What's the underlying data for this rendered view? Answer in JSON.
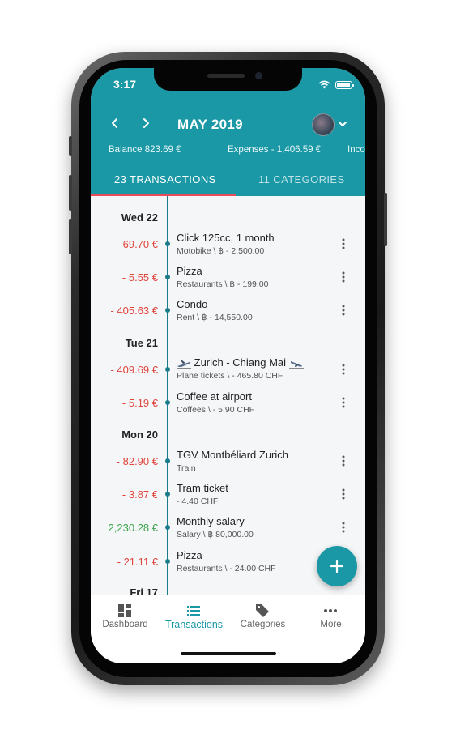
{
  "status_bar": {
    "time": "3:17"
  },
  "header": {
    "month_title": "MAY 2019",
    "balance": "Balance 823.69 €",
    "expenses": "Expenses - 1,406.59 €",
    "income_partial": "Inco"
  },
  "tabs": [
    {
      "label": "23 TRANSACTIONS",
      "active": true
    },
    {
      "label": "11 CATEGORIES",
      "active": false
    }
  ],
  "days": [
    {
      "label": "Wed 22",
      "transactions": [
        {
          "amount": "- 69.70 €",
          "title": "Click 125cc, 1 month",
          "subtitle": "Motobike \\ ฿ - 2,500.00",
          "sign": "neg"
        },
        {
          "amount": "- 5.55 €",
          "title": "Pizza",
          "subtitle": "Restaurants \\ ฿ - 199.00",
          "sign": "neg"
        },
        {
          "amount": "- 405.63 €",
          "title": "Condo",
          "subtitle": "Rent \\ ฿ - 14,550.00",
          "sign": "neg"
        }
      ]
    },
    {
      "label": "Tue 21",
      "transactions": [
        {
          "amount": "- 409.69 €",
          "title": "Zurich - Chiang Mai",
          "subtitle": "Plane tickets \\ - 465.80 CHF",
          "sign": "neg"
        },
        {
          "amount": "- 5.19 €",
          "title": "Coffee at airport",
          "subtitle": "Coffees \\ - 5.90 CHF",
          "sign": "neg"
        }
      ]
    },
    {
      "label": "Mon 20",
      "transactions": [
        {
          "amount": "- 82.90 €",
          "title": "TGV Montbéliard Zurich",
          "subtitle": "Train",
          "sign": "neg"
        },
        {
          "amount": "- 3.87 €",
          "title": "Tram ticket",
          "subtitle": "- 4.40 CHF",
          "sign": "neg"
        },
        {
          "amount": "2,230.28 €",
          "title": "Monthly salary",
          "subtitle": "Salary \\ ฿ 80,000.00",
          "sign": "pos"
        },
        {
          "amount": "- 21.11 €",
          "title": "Pizza",
          "subtitle": "Restaurants \\ - 24.00 CHF",
          "sign": "neg"
        }
      ]
    },
    {
      "label": "Fri 17",
      "transactions": []
    }
  ],
  "bottom_nav": [
    {
      "label": "Dashboard",
      "icon": "dashboard-icon",
      "active": false
    },
    {
      "label": "Transactions",
      "icon": "list-icon",
      "active": true
    },
    {
      "label": "Categories",
      "icon": "tag-icon",
      "active": false
    },
    {
      "label": "More",
      "icon": "more-horizontal-icon",
      "active": false
    }
  ],
  "colors": {
    "primary": "#1b98a6",
    "tab_indicator": "#ec4b5b",
    "negative": "#e0453c",
    "positive": "#3aa54a",
    "timeline": "#1a7b8a"
  }
}
